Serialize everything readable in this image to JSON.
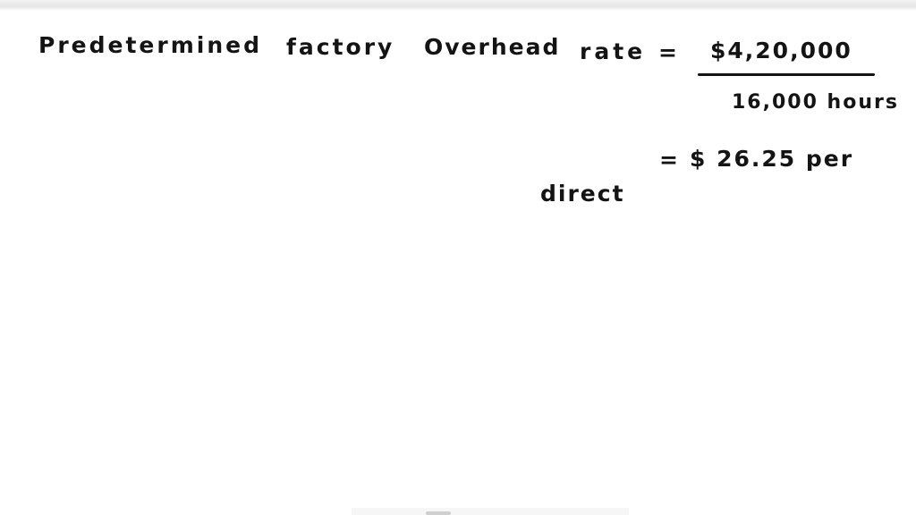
{
  "document": {
    "line1": {
      "term1": "Predetermined",
      "term2": "factory",
      "term3": "Overhead",
      "term4": "rate",
      "equals": "=",
      "numerator": "$4,20,000",
      "denominator": "16,000 hours"
    },
    "line2": {
      "equals": "=",
      "result": "$ 26.25 per",
      "continuation": "direct"
    }
  }
}
